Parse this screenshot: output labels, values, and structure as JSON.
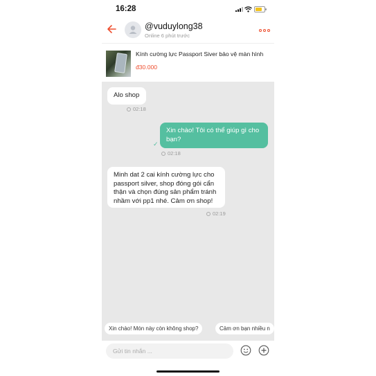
{
  "status_bar": {
    "time": "16:28"
  },
  "header": {
    "username": "@vuduylong38",
    "presence": "Online 6 phút trước"
  },
  "product": {
    "title": "Kính cường lực Passport Siver bảo vệ màn hình",
    "price": "đ30.000"
  },
  "messages": [
    {
      "side": "incoming",
      "text": "Alo shop",
      "time": "02:18"
    },
    {
      "side": "outgoing",
      "text": "Xin chào! Tôi có thể giúp gì cho bạn?",
      "time": "02:18"
    },
    {
      "side": "incoming",
      "text": "Minh dat 2 cai kính cường lực cho passport silver, shop đóng gói cẩn thận và chọn đúng sản phẩm tránh nhầm với pp1 nhé. Cảm ơn shop!",
      "time": "02:19"
    }
  ],
  "quick_replies": [
    "Xin chào! Món này còn không shop?",
    "Cảm ơn bạn nhiều n"
  ],
  "composer": {
    "placeholder": "Gửi tin nhắn ..."
  },
  "colors": {
    "accent": "#ee4d2d",
    "outgoing_bubble": "#55bfa0",
    "chat_background": "#e8e8e8"
  }
}
